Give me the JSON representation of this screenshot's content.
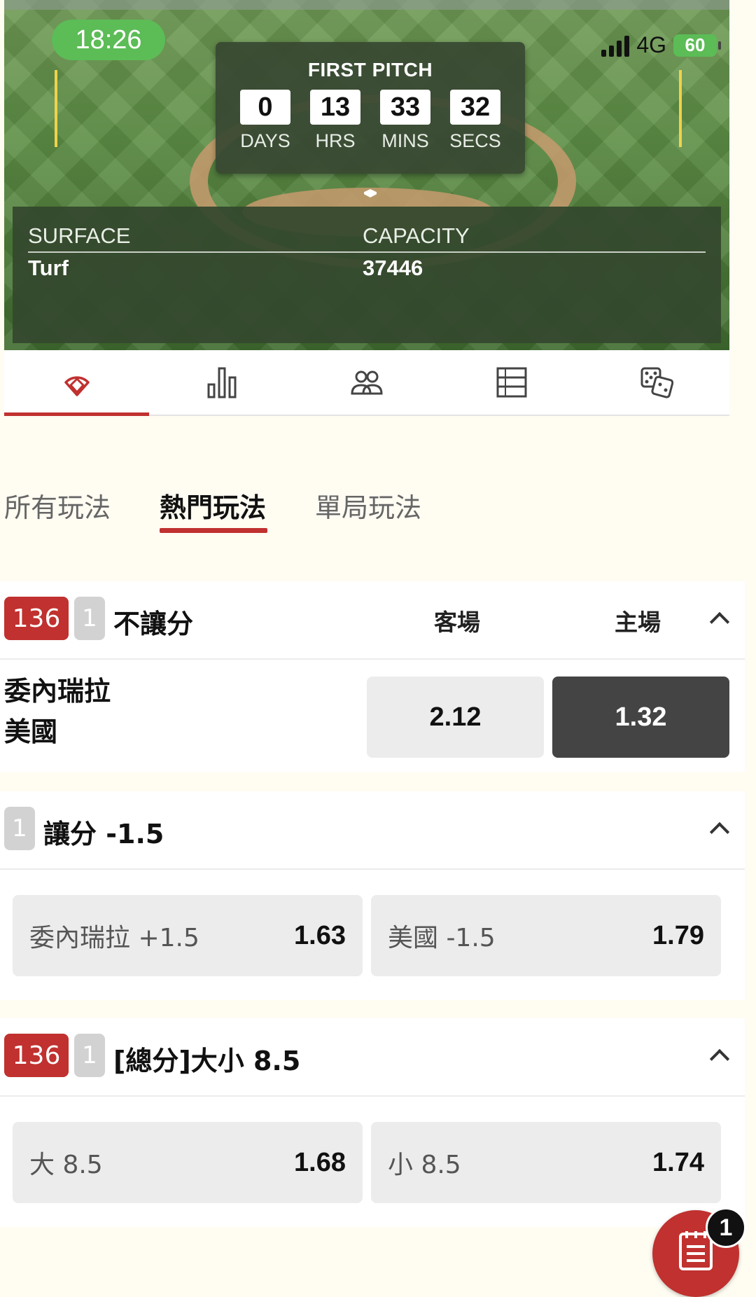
{
  "status_bar": {
    "time": "18:26",
    "network": "4G",
    "battery": "60"
  },
  "countdown": {
    "title": "FIRST PITCH",
    "units": [
      {
        "value": "0",
        "label": "DAYS"
      },
      {
        "value": "13",
        "label": "HRS"
      },
      {
        "value": "33",
        "label": "MINS"
      },
      {
        "value": "32",
        "label": "SECS"
      }
    ]
  },
  "venue": {
    "surface_label": "SURFACE",
    "surface_value": "Turf",
    "capacity_label": "CAPACITY",
    "capacity_value": "37446"
  },
  "icon_tabs": [
    "baseball-field-icon",
    "stats-bar-chart-icon",
    "lineup-people-icon",
    "list-rows-icon",
    "dice-icon"
  ],
  "sub_tabs": {
    "all": "所有玩法",
    "popular": "熱門玩法",
    "innings": "單局玩法"
  },
  "markets": {
    "moneyline": {
      "badge_id": "136",
      "badge_num": "1",
      "title": "不讓分",
      "col_away": "客場",
      "col_home": "主場",
      "team_away": "委內瑞拉",
      "team_home": "美國",
      "odds_away": "2.12",
      "odds_home": "1.32"
    },
    "handicap": {
      "badge_num": "1",
      "title": "讓分 -1.5",
      "opt1_label": "委內瑞拉 +1.5",
      "opt1_odds": "1.63",
      "opt2_label": "美國 -1.5",
      "opt2_odds": "1.79"
    },
    "total": {
      "badge_id": "136",
      "badge_num": "1",
      "title": "[總分]大小 8.5",
      "opt1_label": "大 8.5",
      "opt1_odds": "1.68",
      "opt2_label": "小 8.5",
      "opt2_odds": "1.74"
    }
  },
  "bet_slip": {
    "count": "1"
  },
  "colors": {
    "accent": "#c0312f",
    "selected": "#444444",
    "status_green": "#5cbc56"
  }
}
